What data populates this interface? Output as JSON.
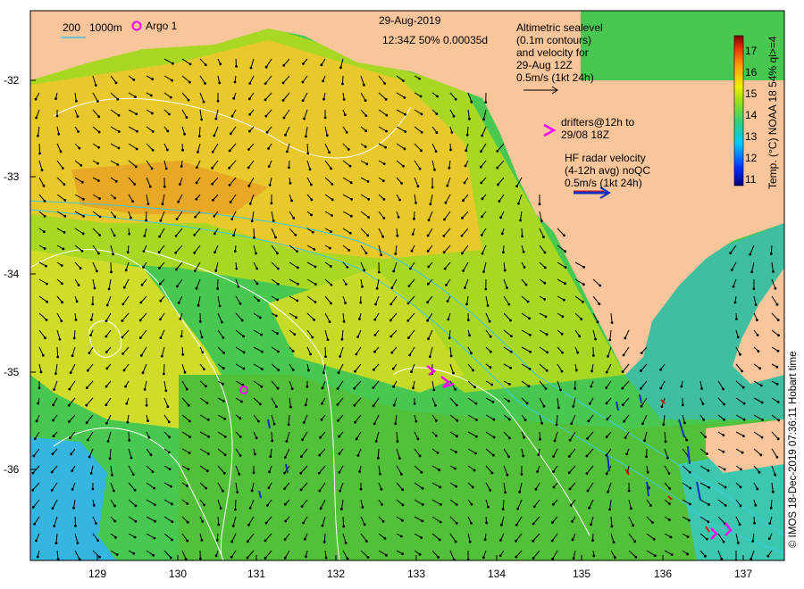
{
  "header": {
    "date": "29-Aug-2019",
    "time_info": "12:34Z  50% 0.00035d"
  },
  "legend": {
    "contours": [
      "200",
      "1000m"
    ],
    "argo_label": "Argo 1"
  },
  "altimetry_note": [
    "Altimetric sealevel",
    "(0.1m contours)",
    "and velocity for",
    "29-Aug 12Z",
    "0.5m/s (1kt 24h)"
  ],
  "drifters_note": [
    "drifters@12h to",
    "29/08 18Z"
  ],
  "hf_radar_note": [
    "HF radar velocity",
    "(4-12h avg) noQC",
    "0.5m/s (1kt 24h)"
  ],
  "axes": {
    "lat_ticks": [
      "-32",
      "-33",
      "-34",
      "-35",
      "-36"
    ],
    "lon_ticks": [
      "129",
      "130",
      "131",
      "132",
      "133",
      "134",
      "135",
      "136",
      "137"
    ]
  },
  "colorbar": {
    "label": "Temp. (°C) NOAA 18 54% ql>=4",
    "ticks": [
      "17",
      "16",
      "15",
      "14",
      "13",
      "12",
      "11"
    ],
    "range": [
      10.7,
      17.6
    ]
  },
  "credit": "© IMOS 18-Dec-2019 07:36:11 Hobart time",
  "colors": {
    "land": "#f9c59b",
    "warm_water": "#e8c82a",
    "mid_water": "#7ed321",
    "cool_water": "#3fbf9f",
    "cold_water": "#35b6e0",
    "contour": "#ffffff",
    "altimetric_arrow": "#000000",
    "drifter": "#ff00ff",
    "hf_radar_arrow": "#1030c0"
  }
}
